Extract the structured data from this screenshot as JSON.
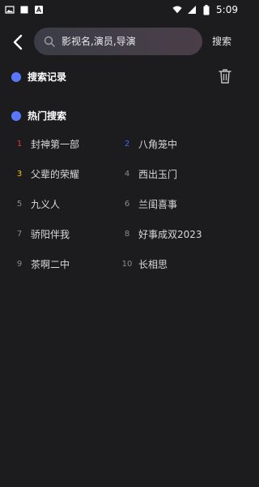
{
  "status_bar": {
    "time": "5:09",
    "left_icons": [
      "image-icon",
      "square-icon",
      "notification-a-icon"
    ],
    "right_icons": [
      "wifi-icon",
      "signal-icon",
      "battery-icon"
    ]
  },
  "top_bar": {
    "search_placeholder": "影视名,演员,导演",
    "search_button": "搜索"
  },
  "sections": {
    "history_title": "搜索记录",
    "hot_title": "热门搜索"
  },
  "colors": {
    "accent_dot": "#5a78ff",
    "rank1": "#e53935",
    "rank2": "#3f68ff",
    "rank3": "#f2c200"
  },
  "hot_searches": [
    {
      "rank": "1",
      "title": "封神第一部"
    },
    {
      "rank": "2",
      "title": "八角笼中"
    },
    {
      "rank": "3",
      "title": "父辈的荣耀"
    },
    {
      "rank": "4",
      "title": "西出玉门"
    },
    {
      "rank": "5",
      "title": "九义人"
    },
    {
      "rank": "6",
      "title": "兰闺喜事"
    },
    {
      "rank": "7",
      "title": "骄阳伴我"
    },
    {
      "rank": "8",
      "title": "好事成双2023"
    },
    {
      "rank": "9",
      "title": "茶啊二中"
    },
    {
      "rank": "10",
      "title": "长相思"
    }
  ]
}
